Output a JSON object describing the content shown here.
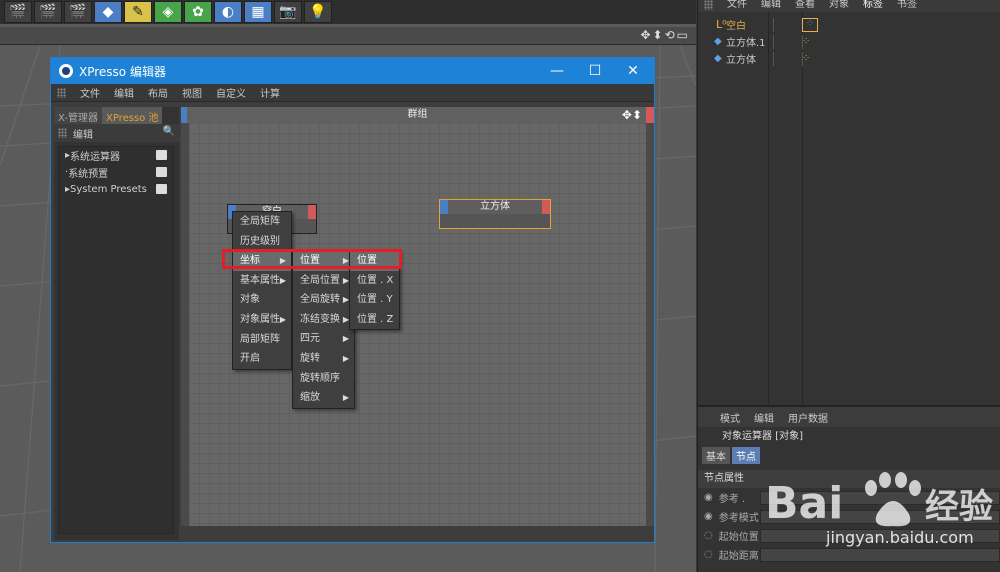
{
  "object_manager": {
    "menu": [
      "文件",
      "编辑",
      "查看",
      "对象",
      "标签",
      "书签"
    ],
    "active_menu": "标签",
    "objects": [
      {
        "name": "空白",
        "selected": true
      },
      {
        "name": "立方体.1",
        "selected": false
      },
      {
        "name": "立方体",
        "selected": false
      }
    ]
  },
  "attribute_manager": {
    "menu": [
      "模式",
      "编辑",
      "用户数据"
    ],
    "title": "对象运算器 [对象]",
    "tabs": [
      "基本",
      "节点"
    ],
    "active_tab": "节点",
    "section": "节点属性",
    "rows": [
      "参考 .",
      "参考模式",
      "起始位置",
      "起始距离"
    ]
  },
  "xpresso": {
    "title": "XPresso 编辑器",
    "menu": [
      "文件",
      "编辑",
      "布局",
      "视图",
      "自定义",
      "计算"
    ],
    "pool_tabs": [
      "X-管理器",
      "XPresso 池"
    ],
    "active_pool_tab": "XPresso 池",
    "pool_toolbar_label": "编辑",
    "pool_items": [
      "系统运算器",
      "系统预置",
      "System Presets"
    ],
    "group_title": "群组",
    "node_right_title": "立方体",
    "node_left_title": "空白"
  },
  "menus": {
    "level1": [
      "全局矩阵",
      "历史级别",
      "坐标",
      "基本属性",
      "对象",
      "对象属性",
      "局部矩阵",
      "开启"
    ],
    "level1_submenu": [
      "坐标",
      "基本属性",
      "对象属性"
    ],
    "level1_highlight": "坐标",
    "level2": [
      "位置",
      "全局位置",
      "全局旋转",
      "冻结变换",
      "四元",
      "旋转",
      "旋转顺序",
      "缩放"
    ],
    "level2_submenu": [
      "位置",
      "全局位置",
      "全局旋转",
      "冻结变换",
      "四元",
      "旋转",
      "缩放"
    ],
    "level2_highlight": "位置",
    "level3": [
      "位置",
      "位置 . X",
      "位置 . Y",
      "位置 . Z"
    ],
    "level3_highlight": "位置"
  },
  "watermark": {
    "brand_text": "Bai",
    "brand_cn": "经验",
    "url": "jingyan.baidu.com"
  },
  "colors": {
    "titlebar": "#1e83d6",
    "highlight_box": "#e21f26",
    "pool_tab_active": "#e0a432"
  }
}
